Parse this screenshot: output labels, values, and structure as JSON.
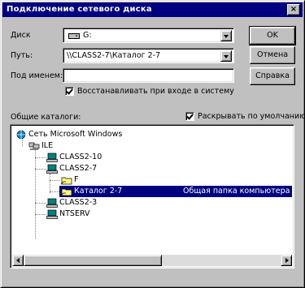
{
  "window": {
    "title": "Подключение сетевого диска",
    "close_glyph": "×"
  },
  "form": {
    "drive_label": "Диск",
    "drive_value": "G:",
    "path_label": "Путь:",
    "path_value": "\\\\CLASS2-7\\Каталог 2-7",
    "username_label": "Под именем:",
    "username_value": "",
    "reconnect_label": "Восстанавливать при входе в систему",
    "reconnect_checked": true,
    "shared_label": "Общие каталоги:",
    "expand_default_label": "Раскрывать по умолчанию",
    "expand_default_checked": true
  },
  "buttons": {
    "ok": "OK",
    "cancel": "Отмена",
    "help": "Справка"
  },
  "tree": {
    "items": [
      {
        "label": "Сеть Microsoft Windows",
        "icon": "network-icon"
      },
      {
        "label": "ILE",
        "icon": "workgroup-icon"
      },
      {
        "label": "CLASS2-10",
        "icon": "computer-icon"
      },
      {
        "label": "CLASS2-7",
        "icon": "computer-icon"
      },
      {
        "label": "F",
        "icon": "shared-folder-icon"
      },
      {
        "label": "Каталог 2-7",
        "icon": "shared-folder-icon",
        "selected": true,
        "description": "Общая папка компьютера stud"
      },
      {
        "label": "CLASS2-3",
        "icon": "computer-icon"
      },
      {
        "label": "NTSERV",
        "icon": "computer-icon"
      }
    ]
  },
  "colors": {
    "title_bar": "#000080",
    "dialog_face": "#c0c0c0",
    "selection": "#000080"
  }
}
